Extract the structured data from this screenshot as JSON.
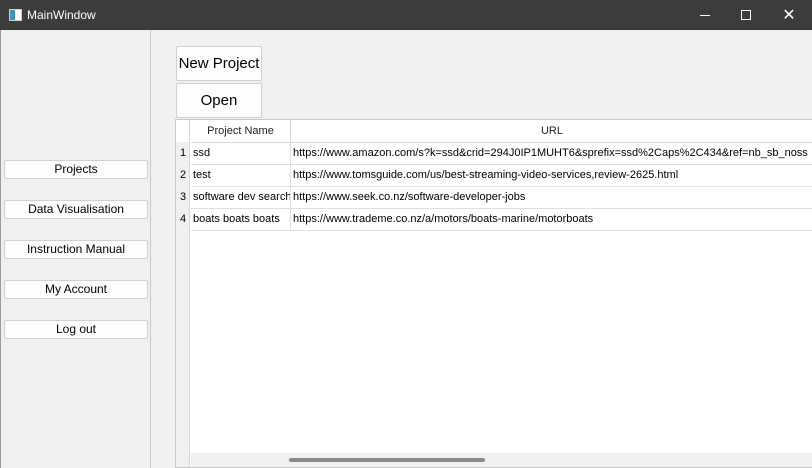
{
  "window": {
    "title": "MainWindow",
    "minimize_glyph": "minimize-icon",
    "maximize_glyph": "maximize-icon",
    "close_label": "✕"
  },
  "sidebar": {
    "items": [
      {
        "label": "Projects"
      },
      {
        "label": "Data Visualisation"
      },
      {
        "label": "Instruction Manual"
      },
      {
        "label": "My Account"
      },
      {
        "label": "Log out"
      }
    ]
  },
  "toolbar": {
    "new_project_label": "New Project",
    "open_label": "Open"
  },
  "table": {
    "columns": [
      "Project Name",
      "URL"
    ],
    "rows": [
      {
        "index": "1",
        "name": "ssd",
        "url": "https://www.amazon.com/s?k=ssd&crid=294J0IP1MUHT6&sprefix=ssd%2Caps%2C434&ref=nb_sb_noss"
      },
      {
        "index": "2",
        "name": "test",
        "url": "https://www.tomsguide.com/us/best-streaming-video-services,review-2625.html"
      },
      {
        "index": "3",
        "name": "software dev search",
        "url": "https://www.seek.co.nz/software-developer-jobs"
      },
      {
        "index": "4",
        "name": "boats boats boats",
        "url": "https://www.trademe.co.nz/a/motors/boats-marine/motorboats"
      }
    ]
  }
}
